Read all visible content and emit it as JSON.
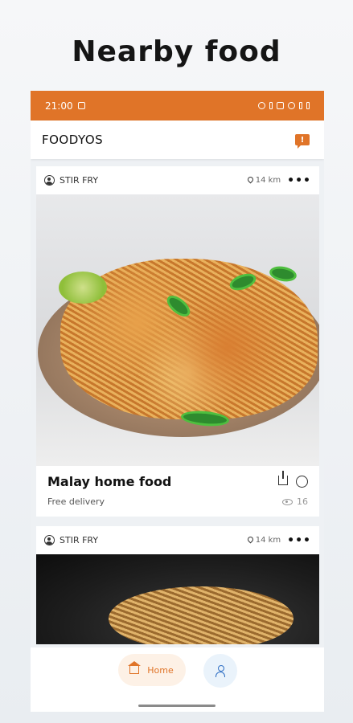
{
  "headline": "Nearby food",
  "status_bar": {
    "time": "21:00"
  },
  "app_bar": {
    "title": "FOODYOS",
    "chat_icon": "message-alert-icon",
    "chat_glyph": "!"
  },
  "posts": [
    {
      "category": "STIR FRY",
      "distance": "14 km",
      "more": "•••",
      "title": "Malay home food",
      "delivery": "Free delivery",
      "views": "16",
      "image": "fried-noodles-photo"
    },
    {
      "category": "STIR FRY",
      "distance": "14 km",
      "more": "•••",
      "image": "wok-noodles-photo"
    }
  ],
  "bottom_nav": {
    "home_label": "Home",
    "profile_icon": "person-icon"
  },
  "colors": {
    "accent": "#e07428",
    "profile": "#2f6fc4"
  }
}
